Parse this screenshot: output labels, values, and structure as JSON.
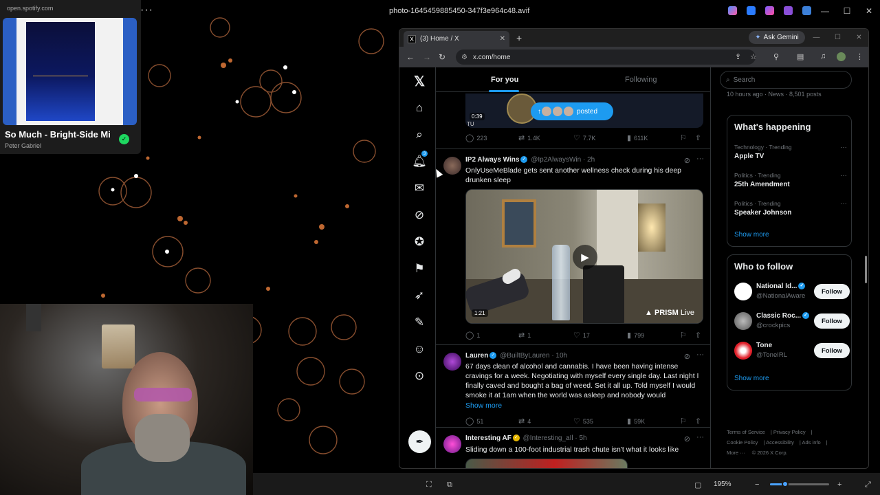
{
  "viewer": {
    "title": "photo-1645459885450-347f3e964c48.avif",
    "zoom": "195%",
    "zoom_fraction": 0.25
  },
  "spotify": {
    "url": "open.spotify.com",
    "track": "So Much - Bright-Side Mi",
    "artist": "Peter Gabriel"
  },
  "browser": {
    "tab_title": "(3) Home / X",
    "tab_favicon": "X",
    "gemini_label": "Ask Gemini",
    "url": "x.com/home"
  },
  "x": {
    "tabs": {
      "for_you": "For you",
      "following": "Following"
    },
    "notifications_count": "3",
    "prev_post": {
      "duration": "0:39",
      "posted_label": "posted",
      "caption": "TU",
      "replies": "223",
      "reposts": "1.4K",
      "likes": "7.7K",
      "views": "611K"
    },
    "posts": [
      {
        "name": "IP2 Always Wins",
        "handle": "@Ip2AlwaysWin",
        "time": "· 2h",
        "text": "OnlyUseMeBlade gets sent another wellness check during his deep drunken sleep",
        "video_duration": "1:21",
        "prism_brand": "PRISM",
        "prism_live": "Live",
        "replies": "1",
        "reposts": "1",
        "likes": "17",
        "views": "799"
      },
      {
        "name": "Lauren",
        "handle": "@BuiltByLauren",
        "time": "· 10h",
        "text": "67 days clean of alcohol and cannabis. I have been having intense cravings for a week. Negotiating with myself every single day. Last night I finally caved and bought a bag of weed. Set it all up. Told myself I would smoke it at 1am when the world was asleep and nobody would",
        "show_more": "Show more",
        "replies": "51",
        "reposts": "4",
        "likes": "535",
        "views": "59K"
      },
      {
        "name": "Interesting AF",
        "handle": "@Interesting_aIl",
        "time": "· 5h",
        "text": "Sliding down a 100-foot industrial trash chute isn't what it looks like"
      }
    ],
    "sidebar": {
      "search_placeholder": "Search",
      "news_meta": "10 hours ago · News · 8,501 posts",
      "whats_happening_title": "What's happening",
      "trends": [
        {
          "category": "Technology · Trending",
          "name": "Apple TV"
        },
        {
          "category": "Politics · Trending",
          "name": "25th Amendment"
        },
        {
          "category": "Politics · Trending",
          "name": "Speaker Johnson"
        }
      ],
      "show_more": "Show more",
      "who_to_follow_title": "Who to follow",
      "follow_suggestions": [
        {
          "name": "National Id...",
          "handle": "@NationalAware",
          "button": "Follow"
        },
        {
          "name": "Classic Roc...",
          "handle": "@crockpics",
          "button": "Follow"
        },
        {
          "name": "Tone",
          "handle": "@ToneIRL",
          "button": "Follow"
        }
      ],
      "show_more_follow": "Show more",
      "footer": {
        "terms": "Terms of Service",
        "privacy": "Privacy Policy",
        "cookie": "Cookie Policy",
        "accessibility": "Accessibility",
        "ads": "Ads info",
        "more": "More ···",
        "copyright": "© 2026 X Corp."
      }
    }
  },
  "colors": {
    "accent": "#1d9bf0",
    "background": "#000000",
    "border": "#2f3336",
    "muted": "#71767b"
  }
}
